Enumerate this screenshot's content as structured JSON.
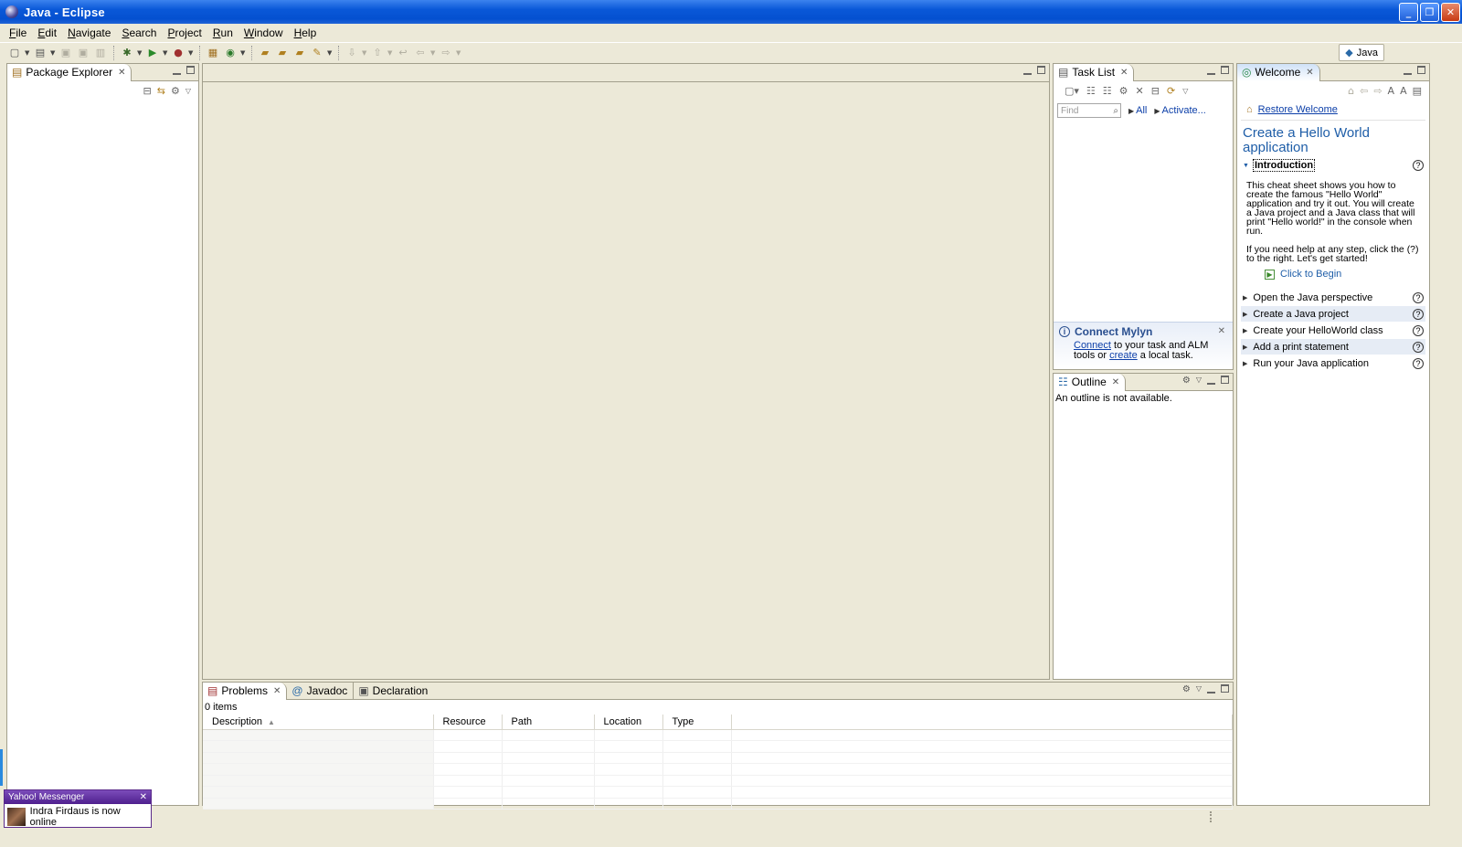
{
  "window": {
    "title": "Java - Eclipse",
    "min_label": "_",
    "restore_label": "❐",
    "close_label": "✕"
  },
  "menu": [
    "File",
    "Edit",
    "Navigate",
    "Search",
    "Project",
    "Run",
    "Window",
    "Help"
  ],
  "perspective": {
    "label": "Java"
  },
  "package_explorer": {
    "tab_label": "Package Explorer"
  },
  "task_list": {
    "tab_label": "Task List",
    "find_placeholder": "Find",
    "all_label": "All",
    "activate_label": "Activate...",
    "mylyn_title": "Connect Mylyn",
    "mylyn_connect": "Connect",
    "mylyn_text_1": " to your task and ALM",
    "mylyn_text_2": "tools or ",
    "mylyn_create": "create",
    "mylyn_text_3": " a local task."
  },
  "outline": {
    "tab_label": "Outline",
    "message": "An outline is not available."
  },
  "welcome": {
    "tab_label": "Welcome",
    "restore_label": "Restore Welcome",
    "title": "Create a Hello World application",
    "intro_label": "Introduction",
    "desc_1": "This cheat sheet shows you how to create the famous \"Hello World\" application and try it out. You will create a Java project and a Java class that will print \"Hello world!\" in the console when run.",
    "desc_2": "If you need help at any step, click the (?) to the right. Let's get started!",
    "begin_label": "Click to Begin",
    "steps": [
      "Open the Java perspective",
      "Create a Java project",
      "Create your HelloWorld class",
      "Add a print statement",
      "Run your Java application"
    ]
  },
  "problems": {
    "tabs": [
      "Problems",
      "Javadoc",
      "Declaration"
    ],
    "count": "0 items",
    "columns": [
      "Description",
      "Resource",
      "Path",
      "Location",
      "Type"
    ]
  },
  "yahoo": {
    "title": "Yahoo! Messenger",
    "message": "Indra Firdaus is now online"
  },
  "colors": {
    "titlebar": "#0a58d8",
    "chrome": "#ece9d8",
    "link": "#0b3ea8",
    "cheatsheet_title": "#1f5ea8"
  }
}
